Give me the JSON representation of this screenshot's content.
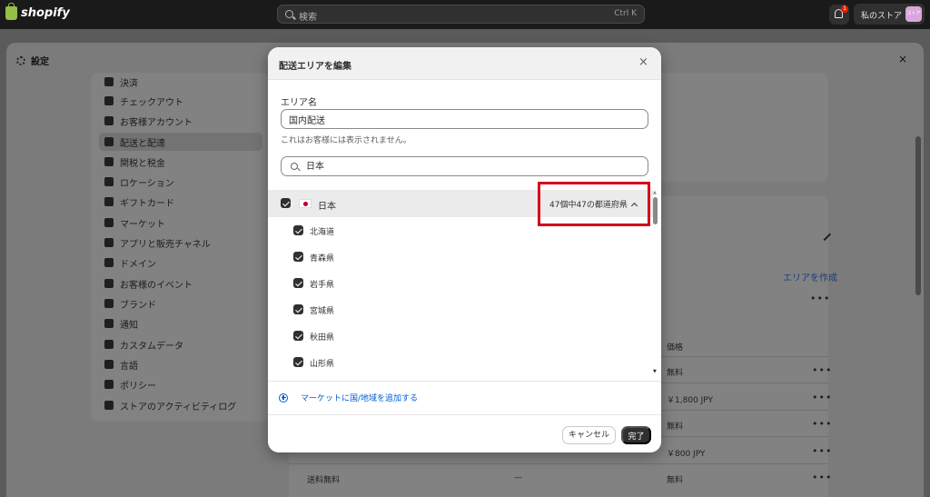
{
  "topbar": {
    "logo_text": "shopify",
    "search_placeholder": "検索",
    "search_shortcut": "Ctrl K",
    "notification_count": "1",
    "store_name": "私のストア",
    "avatar_text": "ストア"
  },
  "settings": {
    "title": "設定",
    "close": "×"
  },
  "sidebar": {
    "items": [
      {
        "label": "決済",
        "icon": "payment-icon"
      },
      {
        "label": "チェックアウト",
        "icon": "cart-icon"
      },
      {
        "label": "お客様アカウント",
        "icon": "person-icon"
      },
      {
        "label": "配送と配達",
        "icon": "truck-icon",
        "active": true
      },
      {
        "label": "関税と税金",
        "icon": "tax-icon"
      },
      {
        "label": "ロケーション",
        "icon": "location-icon"
      },
      {
        "label": "ギフトカード",
        "icon": "gift-card-icon"
      },
      {
        "label": "マーケット",
        "icon": "globe-icon"
      },
      {
        "label": "アプリと販売チャネル",
        "icon": "apps-icon"
      },
      {
        "label": "ドメイン",
        "icon": "globe-icon"
      },
      {
        "label": "お客様のイベント",
        "icon": "events-icon"
      },
      {
        "label": "ブランド",
        "icon": "brand-icon"
      },
      {
        "label": "通知",
        "icon": "bell-icon"
      },
      {
        "label": "カスタムデータ",
        "icon": "data-icon"
      },
      {
        "label": "言語",
        "icon": "language-icon"
      },
      {
        "label": "ポリシー",
        "icon": "policy-icon"
      },
      {
        "label": "ストアのアクティビティログ",
        "icon": "list-icon"
      }
    ]
  },
  "background": {
    "create_zone_link": "エリアを作成",
    "price_header": "価格",
    "rows": [
      {
        "price": "無料"
      },
      {
        "price": "￥1,800 JPY"
      },
      {
        "price": "無料"
      },
      {
        "price": "￥800 JPY"
      },
      {
        "name": "送料無料",
        "dash": "—",
        "price": "無料"
      }
    ]
  },
  "modal": {
    "title": "配送エリアを編集",
    "close": "×",
    "zone_name_label": "エリア名",
    "zone_name_value": "国内配送",
    "zone_name_help": "これはお客様には表示されません。",
    "search_value": "日本",
    "country": {
      "name": "日本",
      "summary": "47個中47の都道府県",
      "checked": true
    },
    "prefectures": [
      {
        "name": "北海道",
        "checked": true
      },
      {
        "name": "青森県",
        "checked": true
      },
      {
        "name": "岩手県",
        "checked": true
      },
      {
        "name": "宮城県",
        "checked": true
      },
      {
        "name": "秋田県",
        "checked": true
      },
      {
        "name": "山形県",
        "checked": true
      }
    ],
    "add_link": "マーケットに国/地域を追加する",
    "cancel_label": "キャンセル",
    "done_label": "完了"
  },
  "colors": {
    "accent_link": "#005bd3",
    "highlight": "#d6001c",
    "primary_button": "#303030"
  }
}
